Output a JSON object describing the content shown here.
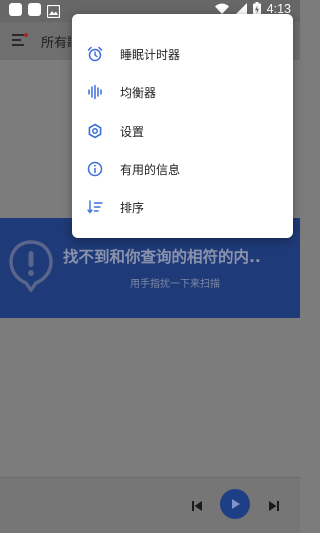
{
  "status_bar": {
    "time": "4:13",
    "battery_icon": "battery-charging-icon",
    "wifi_icon": "wifi-icon",
    "signal_icon": "signal-icon"
  },
  "header": {
    "title": "所有歌曲",
    "menu_icon": "menu-icon"
  },
  "popup_menu": {
    "items": [
      {
        "label": "睡眠计时器",
        "icon": "alarm-clock-icon"
      },
      {
        "label": "均衡器",
        "icon": "equalizer-icon"
      },
      {
        "label": "设置",
        "icon": "settings-icon"
      },
      {
        "label": "有用的信息",
        "icon": "info-icon"
      },
      {
        "label": "排序",
        "icon": "sort-icon"
      }
    ]
  },
  "empty_state": {
    "title": "找不到和你查询的相符的内..",
    "subtitle": "用手指扰一下来扫描",
    "icon": "alert-location-icon"
  },
  "player": {
    "prev_icon": "skip-previous-icon",
    "play_icon": "play-icon",
    "next_icon": "skip-next-icon"
  },
  "colors": {
    "accent": "#3c6fd8",
    "banner": "#1f3a78",
    "scrim": "#7c7c7c"
  }
}
